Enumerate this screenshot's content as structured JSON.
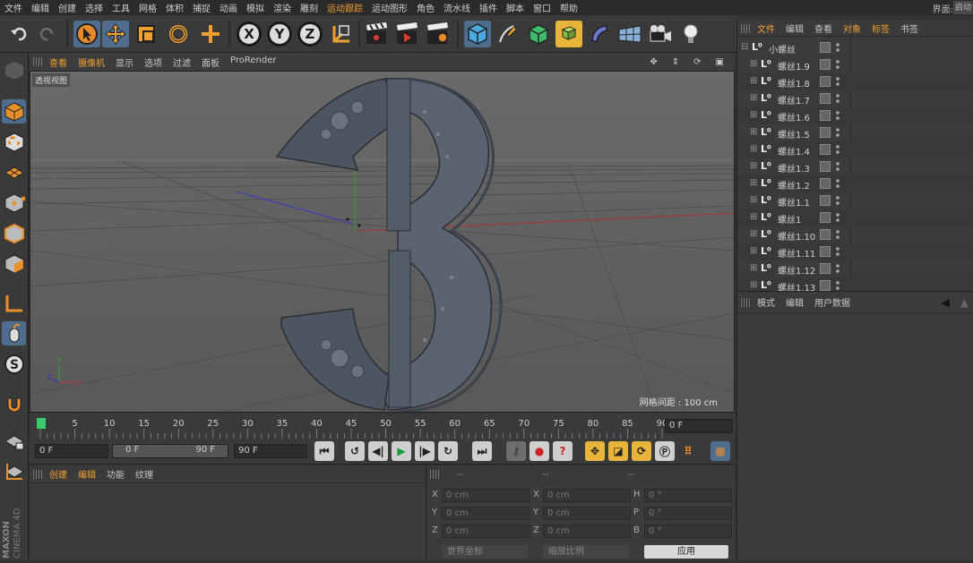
{
  "menu": {
    "items": [
      {
        "label": "文件",
        "hl": false
      },
      {
        "label": "编辑",
        "hl": false
      },
      {
        "label": "创建",
        "hl": false
      },
      {
        "label": "选择",
        "hl": false
      },
      {
        "label": "工具",
        "hl": false
      },
      {
        "label": "网格",
        "hl": false
      },
      {
        "label": "体积",
        "hl": false
      },
      {
        "label": "捕捉",
        "hl": false
      },
      {
        "label": "动画",
        "hl": false
      },
      {
        "label": "模拟",
        "hl": false
      },
      {
        "label": "渲染",
        "hl": false
      },
      {
        "label": "雕刻",
        "hl": false
      },
      {
        "label": "运动跟踪",
        "hl": true
      },
      {
        "label": "运动图形",
        "hl": false
      },
      {
        "label": "角色",
        "hl": false
      },
      {
        "label": "流水线",
        "hl": false
      },
      {
        "label": "插件",
        "hl": false
      },
      {
        "label": "脚本",
        "hl": false
      },
      {
        "label": "窗口",
        "hl": false
      },
      {
        "label": "帮助",
        "hl": false
      }
    ],
    "layout_label": "界面:",
    "layout_value": "启动"
  },
  "viewport": {
    "menu": [
      {
        "label": "查看",
        "hl": true
      },
      {
        "label": "摄像机",
        "hl": true
      },
      {
        "label": "显示",
        "hl": false
      },
      {
        "label": "选项",
        "hl": false
      },
      {
        "label": "过滤",
        "hl": false
      },
      {
        "label": "面板",
        "hl": false
      },
      {
        "label": "ProRender",
        "hl": false
      }
    ],
    "view_name": "透视视图",
    "grid_spacing": "网格间距 : 100 cm",
    "axis_x": "X",
    "axis_y": "Y",
    "axis_z": "Z"
  },
  "timeline": {
    "ticks": [
      "0",
      "5",
      "10",
      "15",
      "20",
      "25",
      "30",
      "35",
      "40",
      "45",
      "50",
      "55",
      "60",
      "65",
      "70",
      "75",
      "80",
      "85",
      "90"
    ],
    "current_frame": "0 F"
  },
  "transport": {
    "start_field": "0 F",
    "range_left": "0 F",
    "range_right": "90 F",
    "end_field": "90 F"
  },
  "materials": {
    "tabs": [
      "创建",
      "编辑",
      "功能",
      "纹理"
    ]
  },
  "coordinates": {
    "headers": [
      "--",
      "--",
      "--"
    ],
    "rows": [
      {
        "a_label": "X",
        "a_val": "0 cm",
        "b_label": "X",
        "b_val": "0 cm",
        "c_label": "H",
        "c_val": "0 °"
      },
      {
        "a_label": "Y",
        "a_val": "0 cm",
        "b_label": "Y",
        "b_val": "0 cm",
        "c_label": "P",
        "c_val": "0 °"
      },
      {
        "a_label": "Z",
        "a_val": "0 cm",
        "b_label": "Z",
        "b_val": "0 cm",
        "c_label": "B",
        "c_val": "0 °"
      }
    ],
    "mode_select": "世界坐标",
    "scale_select": "缩放比例",
    "apply_label": "应用"
  },
  "objects": {
    "tabs": [
      {
        "label": "文件",
        "hl": true
      },
      {
        "label": "编辑",
        "hl": false
      },
      {
        "label": "查看",
        "hl": false
      },
      {
        "label": "对象",
        "hl": true
      },
      {
        "label": "标签",
        "hl": true
      },
      {
        "label": "书签",
        "hl": false
      }
    ],
    "root": "小螺丝",
    "items": [
      "螺丝1.9",
      "螺丝1.8",
      "螺丝1.7",
      "螺丝1.6",
      "螺丝1.5",
      "螺丝1.4",
      "螺丝1.3",
      "螺丝1.2",
      "螺丝1.1",
      "螺丝1",
      "螺丝1.10",
      "螺丝1.11",
      "螺丝1.12",
      "螺丝1.13"
    ]
  },
  "attributes": {
    "tabs": [
      "模式",
      "编辑",
      "用户数据"
    ]
  },
  "branding": {
    "maker": "MAXON",
    "product": "CINEMA 4D"
  },
  "colors": {
    "accent": "#f0a030",
    "selected": "#4f6d8f",
    "axis_x": "#c03030",
    "axis_y": "#30a030",
    "axis_z": "#3040c0"
  }
}
